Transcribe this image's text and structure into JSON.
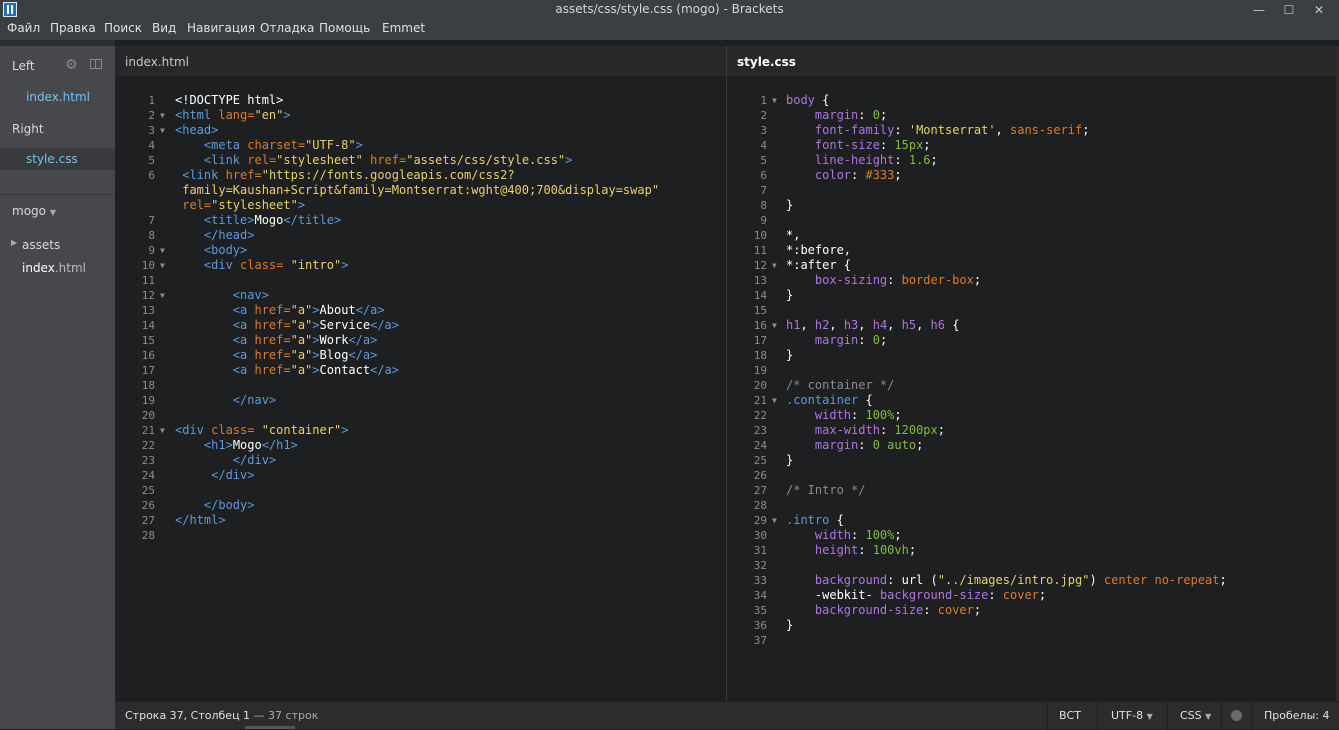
{
  "window": {
    "title": "assets/css/style.css (mogo) - Brackets",
    "minimize": "—",
    "maximize": "☐",
    "close": "✕"
  },
  "menu": [
    "Файл",
    "Правка",
    "Поиск",
    "Вид",
    "Навигация",
    "Отладка",
    "Помощь",
    "Emmet"
  ],
  "sidebar": {
    "left_label": "Left",
    "left_file": "index.html",
    "right_label": "Right",
    "right_file": "style.css",
    "project_name": "mogo",
    "folder": "assets",
    "file_name": "index",
    "file_ext": ".html"
  },
  "left_pane": {
    "title": "index.html",
    "lines": [
      [
        [
          "k",
          "<!DOCTYPE html>"
        ]
      ],
      [
        [
          "t",
          "<html "
        ],
        [
          "a",
          "lang="
        ],
        [
          "v",
          "\"en\""
        ],
        [
          "t",
          ">"
        ]
      ],
      [
        [
          "t",
          "<head>"
        ]
      ],
      [
        [
          "w",
          "    "
        ],
        [
          "t",
          "<meta "
        ],
        [
          "a",
          "charset="
        ],
        [
          "v",
          "\"UTF-8\""
        ],
        [
          "t",
          ">"
        ]
      ],
      [
        [
          "w",
          "    "
        ],
        [
          "t",
          "<link "
        ],
        [
          "a",
          "rel="
        ],
        [
          "v",
          "\"stylesheet\" "
        ],
        [
          "a",
          "href="
        ],
        [
          "v",
          "\"assets/css/style.css\""
        ],
        [
          "t",
          ">"
        ]
      ],
      [
        [
          "w",
          " "
        ],
        [
          "t",
          "<link "
        ],
        [
          "a",
          "href="
        ],
        [
          "v",
          "\"https://fonts.googleapis.com/css2?"
        ]
      ],
      [
        [
          "v",
          " family=Kaushan+Script&family=Montserrat:wght@400;700&display=swap\""
        ]
      ],
      [
        [
          "a",
          " rel="
        ],
        [
          "v",
          "\"stylesheet\""
        ],
        [
          "t",
          ">"
        ]
      ],
      [
        [
          "w",
          "    "
        ],
        [
          "t",
          "<title>"
        ],
        [
          "k",
          "Mogo"
        ],
        [
          "t",
          "</title>"
        ]
      ],
      [
        [
          "w",
          "    "
        ],
        [
          "t",
          "</head>"
        ]
      ],
      [
        [
          "w",
          "    "
        ],
        [
          "t",
          "<body>"
        ]
      ],
      [
        [
          "w",
          "    "
        ],
        [
          "t",
          "<div "
        ],
        [
          "a",
          "class= "
        ],
        [
          "v",
          "\"intro\""
        ],
        [
          "t",
          ">"
        ]
      ],
      [],
      [
        [
          "w",
          "        "
        ],
        [
          "t",
          "<nav>"
        ]
      ],
      [
        [
          "w",
          "        "
        ],
        [
          "t",
          "<a "
        ],
        [
          "a",
          "href="
        ],
        [
          "v",
          "\"a\""
        ],
        [
          "t",
          ">"
        ],
        [
          "k",
          "About"
        ],
        [
          "t",
          "</a>"
        ]
      ],
      [
        [
          "w",
          "        "
        ],
        [
          "t",
          "<a "
        ],
        [
          "a",
          "href="
        ],
        [
          "v",
          "\"a\""
        ],
        [
          "t",
          ">"
        ],
        [
          "k",
          "Service"
        ],
        [
          "t",
          "</a>"
        ]
      ],
      [
        [
          "w",
          "        "
        ],
        [
          "t",
          "<a "
        ],
        [
          "a",
          "href="
        ],
        [
          "v",
          "\"a\""
        ],
        [
          "t",
          ">"
        ],
        [
          "k",
          "Work"
        ],
        [
          "t",
          "</a>"
        ]
      ],
      [
        [
          "w",
          "        "
        ],
        [
          "t",
          "<a "
        ],
        [
          "a",
          "href="
        ],
        [
          "v",
          "\"a\""
        ],
        [
          "t",
          ">"
        ],
        [
          "k",
          "Blog"
        ],
        [
          "t",
          "</a>"
        ]
      ],
      [
        [
          "w",
          "        "
        ],
        [
          "t",
          "<a "
        ],
        [
          "a",
          "href="
        ],
        [
          "v",
          "\"a\""
        ],
        [
          "t",
          ">"
        ],
        [
          "k",
          "Contact"
        ],
        [
          "t",
          "</a>"
        ]
      ],
      [],
      [
        [
          "w",
          "        "
        ],
        [
          "t",
          "</nav>"
        ]
      ],
      [],
      [
        [
          "t",
          "<div "
        ],
        [
          "a",
          "class= "
        ],
        [
          "v",
          "\"container\""
        ],
        [
          "t",
          ">"
        ]
      ],
      [
        [
          "w",
          "    "
        ],
        [
          "t",
          "<h1>"
        ],
        [
          "k",
          "Mogo"
        ],
        [
          "t",
          "</h1>"
        ]
      ],
      [
        [
          "w",
          "        "
        ],
        [
          "t",
          "</div>"
        ]
      ],
      [
        [
          "w",
          "     "
        ],
        [
          "t",
          "</div>"
        ]
      ],
      [],
      [
        [
          "w",
          "    "
        ],
        [
          "t",
          "</body>"
        ]
      ],
      [
        [
          "t",
          "</html>"
        ]
      ],
      []
    ],
    "line_numbers": [
      "1",
      "2",
      "3",
      "4",
      "5",
      "6",
      "",
      "",
      "7",
      "8",
      "9",
      "10",
      "11",
      "12",
      "13",
      "14",
      "15",
      "16",
      "17",
      "18",
      "19",
      "20",
      "21",
      "22",
      "23",
      "24",
      "25",
      "26",
      "27",
      "28"
    ],
    "folds": [
      "",
      "▼",
      "▼",
      "",
      "",
      "",
      "",
      "",
      "",
      "",
      "▼",
      "▼",
      "",
      "▼",
      "",
      "",
      "",
      "",
      "",
      "",
      "",
      "",
      "▼",
      "",
      "",
      "",
      "",
      "",
      "",
      ""
    ]
  },
  "right_pane": {
    "title": "style.css",
    "lines": [
      [
        [
          "p",
          "body"
        ],
        [
          "k",
          " {"
        ]
      ],
      [
        [
          "w",
          "    "
        ],
        [
          "p",
          "margin"
        ],
        [
          "k",
          ": "
        ],
        [
          "n",
          "0"
        ],
        [
          "k",
          ";"
        ]
      ],
      [
        [
          "w",
          "    "
        ],
        [
          "p",
          "font-family"
        ],
        [
          "k",
          ": "
        ],
        [
          "v",
          "'Montserrat'"
        ],
        [
          "k",
          ", "
        ],
        [
          "s",
          "sans-serif"
        ],
        [
          "k",
          ";"
        ]
      ],
      [
        [
          "w",
          "    "
        ],
        [
          "p",
          "font-size"
        ],
        [
          "k",
          ": "
        ],
        [
          "n",
          "15px"
        ],
        [
          "k",
          ";"
        ]
      ],
      [
        [
          "w",
          "    "
        ],
        [
          "p",
          "line-height"
        ],
        [
          "k",
          ": "
        ],
        [
          "n",
          "1.6"
        ],
        [
          "k",
          ";"
        ]
      ],
      [
        [
          "w",
          "    "
        ],
        [
          "p",
          "color"
        ],
        [
          "k",
          ": "
        ],
        [
          "s",
          "#333"
        ],
        [
          "k",
          ";"
        ]
      ],
      [],
      [
        [
          "k",
          "}"
        ]
      ],
      [],
      [
        [
          "k",
          "*,"
        ]
      ],
      [
        [
          "k",
          "*:before,"
        ]
      ],
      [
        [
          "k",
          "*:after {"
        ]
      ],
      [
        [
          "w",
          "    "
        ],
        [
          "p",
          "box-sizing"
        ],
        [
          "k",
          ": "
        ],
        [
          "s",
          "border-box"
        ],
        [
          "k",
          ";"
        ]
      ],
      [
        [
          "k",
          "}"
        ]
      ],
      [],
      [
        [
          "p",
          "h1"
        ],
        [
          "k",
          ", "
        ],
        [
          "p",
          "h2"
        ],
        [
          "k",
          ", "
        ],
        [
          "p",
          "h3"
        ],
        [
          "k",
          ", "
        ],
        [
          "p",
          "h4"
        ],
        [
          "k",
          ", "
        ],
        [
          "p",
          "h5"
        ],
        [
          "k",
          ", "
        ],
        [
          "p",
          "h6"
        ],
        [
          "k",
          " {"
        ]
      ],
      [
        [
          "w",
          "    "
        ],
        [
          "p",
          "margin"
        ],
        [
          "k",
          ": "
        ],
        [
          "n",
          "0"
        ],
        [
          "k",
          ";"
        ]
      ],
      [
        [
          "k",
          "}"
        ]
      ],
      [],
      [
        [
          "c",
          "/* container */"
        ]
      ],
      [
        [
          "t",
          ".container"
        ],
        [
          "k",
          " {"
        ]
      ],
      [
        [
          "w",
          "    "
        ],
        [
          "p",
          "width"
        ],
        [
          "k",
          ": "
        ],
        [
          "n",
          "100%"
        ],
        [
          "k",
          ";"
        ]
      ],
      [
        [
          "w",
          "    "
        ],
        [
          "p",
          "max-width"
        ],
        [
          "k",
          ": "
        ],
        [
          "n",
          "1200px"
        ],
        [
          "k",
          ";"
        ]
      ],
      [
        [
          "w",
          "    "
        ],
        [
          "p",
          "margin"
        ],
        [
          "k",
          ": "
        ],
        [
          "n",
          "0 auto"
        ],
        [
          "k",
          ";"
        ]
      ],
      [
        [
          "k",
          "}"
        ]
      ],
      [],
      [
        [
          "c",
          "/* Intro */"
        ]
      ],
      [],
      [
        [
          "t",
          ".intro"
        ],
        [
          "k",
          " {"
        ]
      ],
      [
        [
          "w",
          "    "
        ],
        [
          "p",
          "width"
        ],
        [
          "k",
          ": "
        ],
        [
          "n",
          "100%"
        ],
        [
          "k",
          ";"
        ]
      ],
      [
        [
          "w",
          "    "
        ],
        [
          "p",
          "height"
        ],
        [
          "k",
          ": "
        ],
        [
          "n",
          "100vh"
        ],
        [
          "k",
          ";"
        ]
      ],
      [],
      [
        [
          "w",
          "    "
        ],
        [
          "p",
          "background"
        ],
        [
          "k",
          ": "
        ],
        [
          "k",
          "url ("
        ],
        [
          "v",
          "\"../images/intro.jpg\""
        ],
        [
          "k",
          ") "
        ],
        [
          "s",
          "center no-repeat"
        ],
        [
          "k",
          ";"
        ]
      ],
      [
        [
          "w",
          "    "
        ],
        [
          "k",
          "-webkit- "
        ],
        [
          "p",
          "background-size"
        ],
        [
          "k",
          ": "
        ],
        [
          "s",
          "cover"
        ],
        [
          "k",
          ";"
        ]
      ],
      [
        [
          "w",
          "    "
        ],
        [
          "p",
          "background-size"
        ],
        [
          "k",
          ": "
        ],
        [
          "s",
          "cover"
        ],
        [
          "k",
          ";"
        ]
      ],
      [
        [
          "k",
          "}"
        ]
      ],
      []
    ],
    "folds": [
      "▼",
      "",
      "",
      "",
      "",
      "",
      "",
      "",
      "",
      "",
      "",
      "▼",
      "",
      "",
      "",
      "▼",
      "",
      "",
      "",
      "",
      "▼",
      "",
      "",
      "",
      "",
      "",
      "",
      "",
      "▼",
      "",
      "",
      "",
      "",
      "",
      "",
      "",
      ""
    ]
  },
  "status": {
    "position": "Строка 37, Столбец 1",
    "line_count": " — 37 строк",
    "insert_mode": "ВСТ",
    "encoding": "UTF-8",
    "language": "CSS",
    "indent_label": "Пробелы:",
    "indent_value": "4"
  }
}
